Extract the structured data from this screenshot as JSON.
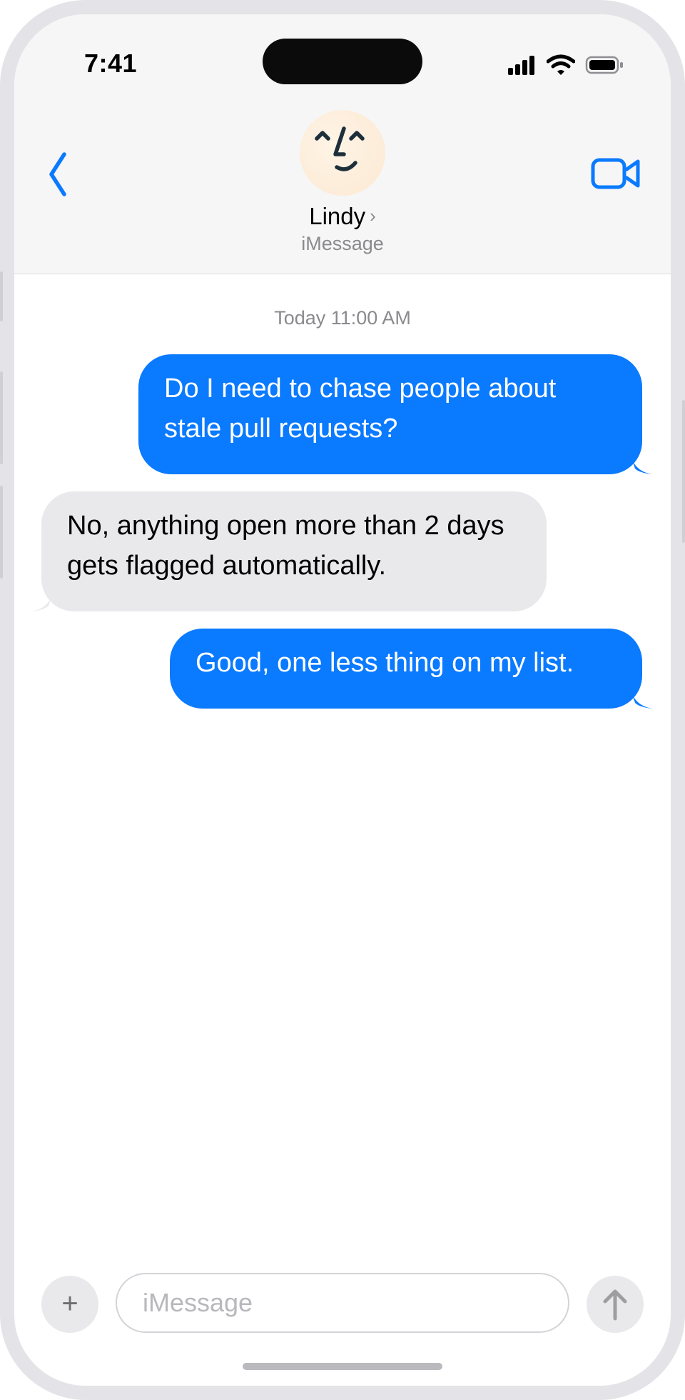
{
  "status_bar": {
    "time": "7:41",
    "icons": [
      "signal-icon",
      "wifi-icon",
      "battery-icon"
    ]
  },
  "header": {
    "contact_name": "Lindy",
    "chevron": "›",
    "subtitle": "iMessage",
    "back_icon": "chevron-left-icon",
    "video_icon": "video-camera-icon"
  },
  "conversation": {
    "timestamp": "Today 11:00 AM",
    "messages": [
      {
        "direction": "outgoing",
        "text": "Do I need to chase people about stale pull requests?"
      },
      {
        "direction": "incoming",
        "text": "No, anything open more than 2 days gets flagged automatically."
      },
      {
        "direction": "outgoing",
        "text": "Good, one less thing on my list."
      }
    ]
  },
  "composer": {
    "plus_label": "+",
    "placeholder": "iMessage",
    "value": "",
    "send_icon": "arrow-up-icon"
  },
  "colors": {
    "accent": "#0a7aff",
    "incoming_bubble": "#e9e9eb",
    "header_bg": "#f6f6f6"
  }
}
